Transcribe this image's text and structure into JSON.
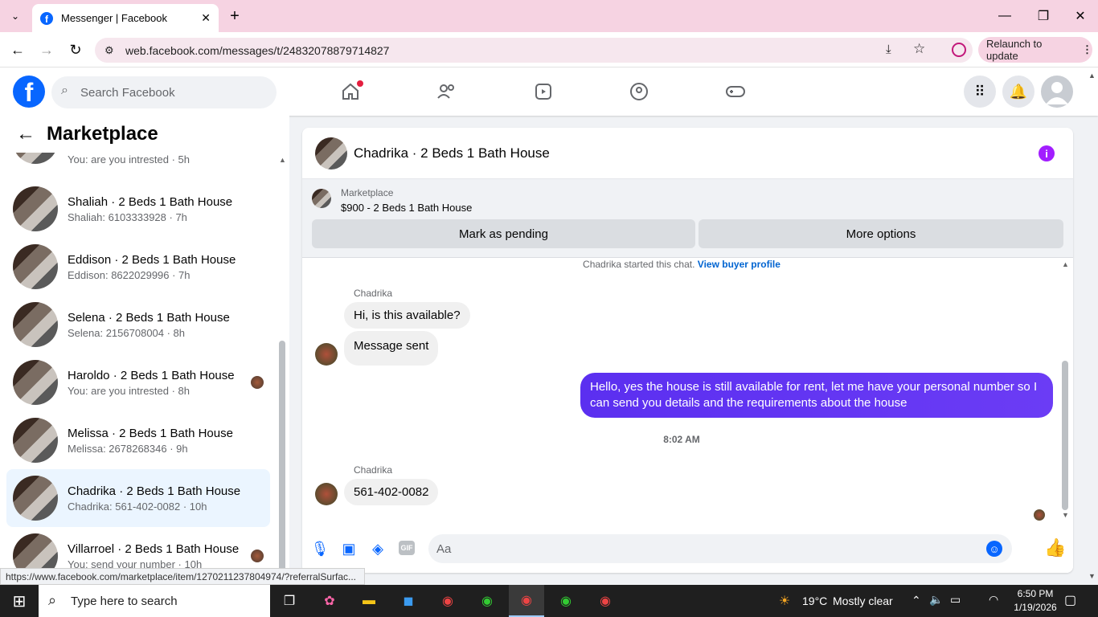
{
  "browser": {
    "tab_title": "Messenger | Facebook",
    "url": "web.facebook.com/messages/t/24832078879714827",
    "relaunch_label": "Relaunch to update"
  },
  "fb": {
    "search_placeholder": "Search Facebook"
  },
  "left": {
    "title": "Marketplace",
    "conversations": [
      {
        "name": "",
        "sub": "You: are you intrested · 5h"
      },
      {
        "name": "Shaliah · 2 Beds 1 Bath House",
        "sub": "Shaliah: 6103333928 · 7h"
      },
      {
        "name": "Eddison · 2 Beds 1 Bath House",
        "sub": "Eddison: 8622029996 · 7h"
      },
      {
        "name": "Selena · 2 Beds 1 Bath House",
        "sub": "Selena: 2156708004 · 8h"
      },
      {
        "name": "Haroldo · 2 Beds 1 Bath House",
        "sub": "You: are you intrested · 8h"
      },
      {
        "name": "Melissa · 2 Beds 1 Bath House",
        "sub": "Melissa: 2678268346 · 9h"
      },
      {
        "name": "Chadrika · 2 Beds 1 Bath House",
        "sub": "Chadrika: 561-402-0082 · 10h"
      },
      {
        "name": "Villarroel · 2 Beds 1 Bath House",
        "sub": "You: send your number · 10h"
      }
    ]
  },
  "chat": {
    "title": "Chadrika · 2 Beds 1 Bath House",
    "marketplace_label": "Marketplace",
    "listing": "$900 - 2 Beds 1 Bath House",
    "mark_pending": "Mark as pending",
    "more_options": "More options",
    "started": "Chadrika started this chat.",
    "view_profile": "View buyer profile",
    "sender": "Chadrika",
    "msg1": "Hi, is this available?",
    "msg2": "Message sent",
    "out": "Hello, yes the house is still available for rent, let me have your personal number so I can send you details and the requirements about the house",
    "time": "8:02 AM",
    "msg3": "561-402-0082",
    "composer_placeholder": "Aa"
  },
  "status_url": "https://www.facebook.com/marketplace/item/1270211237804974/?referralSurfac...",
  "taskbar": {
    "search": "Type here to search",
    "temp": "19°C",
    "weather": "Mostly clear",
    "time": "6:50 PM",
    "date": "1/19/2026"
  },
  "colors": {
    "fb_blue": "#0866ff",
    "outgoing": "#6236f2",
    "info": "#a21eff"
  }
}
